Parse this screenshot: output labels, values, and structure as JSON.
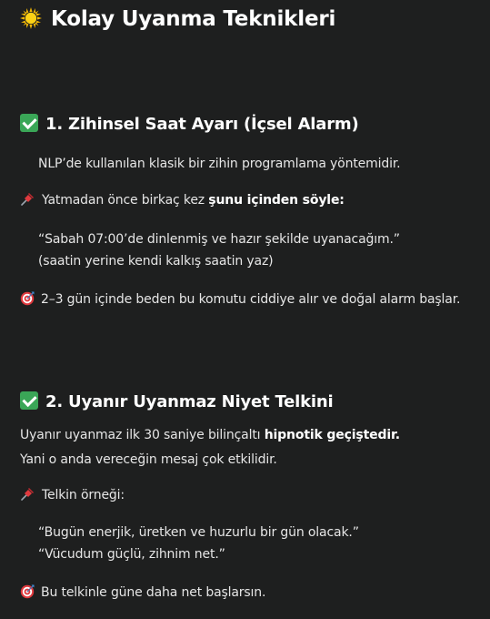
{
  "title": "Kolay Uyanma Teknikleri",
  "section1": {
    "heading": "1. Zihinsel Saat Ayarı (İçsel Alarm)",
    "intro": "NLP’de kullanılan klasik bir zihin programlama yöntemidir.",
    "instruction_prefix": "Yatmadan önce birkaç kez ",
    "instruction_bold": "şunu içinden söyle:",
    "quote_line1": "“Sabah 07:00’de dinlenmiş ve hazır şekilde uyanacağım.”",
    "quote_line2": "(saatin yerine kendi kalkış saatin yaz)",
    "result": "2–3 gün içinde beden bu komutu ciddiye alır ve doğal alarm başlar."
  },
  "section2": {
    "heading": "2. Uyanır Uyanmaz Niyet Telkini",
    "line1_prefix": "Uyanır uyanmaz ilk 30 saniye bilinçaltı ",
    "line1_bold": "hipnotik geçiştedir.",
    "line2": "Yani o anda vereceğin mesaj çok etkilidir.",
    "example_label": "Telkin örneği:",
    "quote_line1": "“Bugün enerjik, üretken ve huzurlu bir gün olacak.”",
    "quote_line2": "“Vücudum güçlü, zihnim net.”",
    "result": "Bu telkinle güne daha net başlarsın."
  },
  "icons": {
    "title": "sun-icon",
    "heading": "check-mark-icon",
    "note": "pushpin-icon",
    "result": "target-icon"
  }
}
